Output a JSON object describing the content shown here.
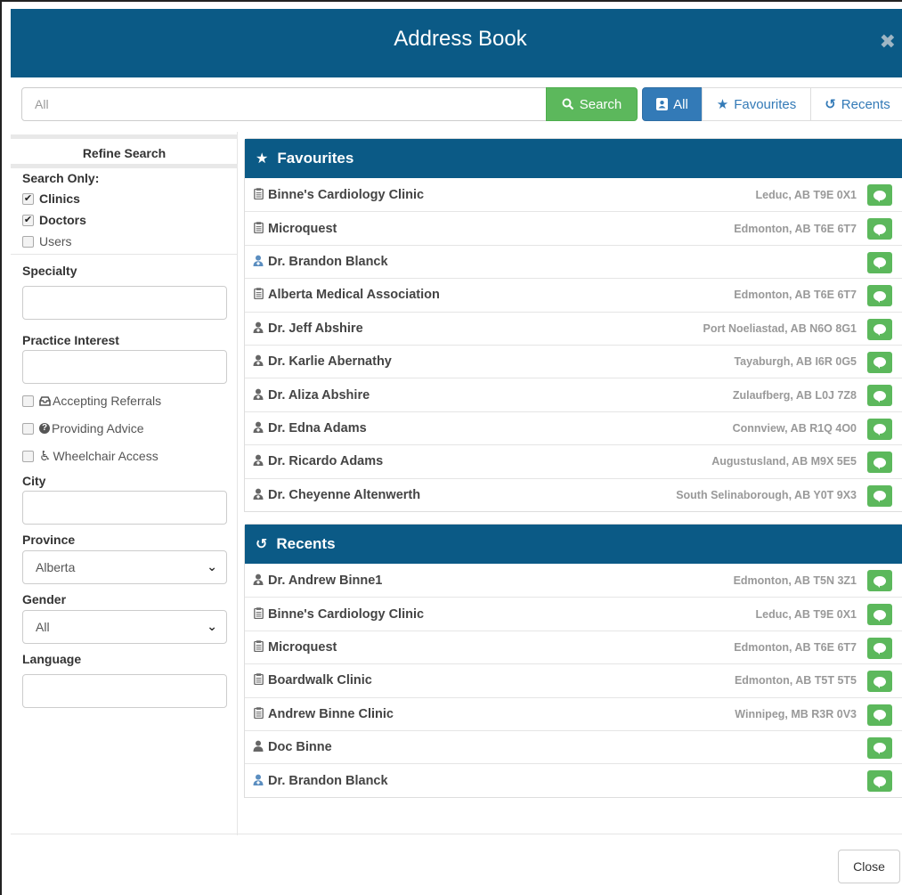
{
  "header": {
    "title": "Address Book",
    "close_glyph": "✖"
  },
  "search": {
    "placeholder": "All",
    "search_label": "Search",
    "filters": {
      "all": "All",
      "favourites": "Favourites",
      "recents": "Recents"
    }
  },
  "sidebar": {
    "title": "Refine Search",
    "search_only": {
      "label": "Search Only:",
      "options": [
        {
          "label": "Clinics",
          "checked": true
        },
        {
          "label": "Doctors",
          "checked": true
        },
        {
          "label": "Users",
          "checked": false
        }
      ]
    },
    "specialty_label": "Specialty",
    "practice_interest_label": "Practice Interest",
    "features": [
      {
        "label": "Accepting Referrals",
        "icon": "inbox-icon"
      },
      {
        "label": "Providing Advice",
        "icon": "question-circle-icon"
      },
      {
        "label": "Wheelchair Access",
        "icon": "wheelchair-icon"
      }
    ],
    "city_label": "City",
    "province": {
      "label": "Province",
      "value": "Alberta"
    },
    "gender": {
      "label": "Gender",
      "value": "All"
    },
    "language_label": "Language"
  },
  "favourites": {
    "title": "Favourites",
    "items": [
      {
        "type": "clinic",
        "name": "Binne's Cardiology Clinic",
        "location": "Leduc, AB T9E 0X1"
      },
      {
        "type": "clinic",
        "name": "Microquest",
        "location": "Edmonton, AB T6E 6T7"
      },
      {
        "type": "doctor-blue",
        "name": "Dr. Brandon Blanck",
        "location": ""
      },
      {
        "type": "clinic",
        "name": "Alberta Medical Association",
        "location": "Edmonton, AB T6E 6T7"
      },
      {
        "type": "doctor",
        "name": "Dr. Jeff Abshire",
        "location": "Port Noeliastad, AB N6O 8G1"
      },
      {
        "type": "doctor",
        "name": "Dr. Karlie Abernathy",
        "location": "Tayaburgh, AB I6R 0G5"
      },
      {
        "type": "doctor",
        "name": "Dr. Aliza Abshire",
        "location": "Zulaufberg, AB L0J 7Z8"
      },
      {
        "type": "doctor",
        "name": "Dr. Edna Adams",
        "location": "Connview, AB R1Q 4O0"
      },
      {
        "type": "doctor",
        "name": "Dr. Ricardo Adams",
        "location": "Augustusland, AB M9X 5E5"
      },
      {
        "type": "doctor",
        "name": "Dr. Cheyenne Altenwerth",
        "location": "South Selinaborough, AB Y0T 9X3"
      }
    ]
  },
  "recents": {
    "title": "Recents",
    "items": [
      {
        "type": "doctor",
        "name": "Dr. Andrew Binne1",
        "location": "Edmonton, AB T5N 3Z1"
      },
      {
        "type": "clinic",
        "name": "Binne's Cardiology Clinic",
        "location": "Leduc, AB T9E 0X1"
      },
      {
        "type": "clinic",
        "name": "Microquest",
        "location": "Edmonton, AB T6E 6T7"
      },
      {
        "type": "clinic",
        "name": "Boardwalk Clinic",
        "location": "Edmonton, AB T5T 5T5"
      },
      {
        "type": "clinic",
        "name": "Andrew Binne Clinic",
        "location": "Winnipeg, MB R3R 0V3"
      },
      {
        "type": "user",
        "name": "Doc Binne",
        "location": ""
      },
      {
        "type": "doctor-blue",
        "name": "Dr. Brandon Blanck",
        "location": ""
      }
    ]
  },
  "footer": {
    "close_label": "Close"
  },
  "colors": {
    "primary": "#0b5a86",
    "success": "#5cb85c",
    "link": "#337ab7"
  }
}
